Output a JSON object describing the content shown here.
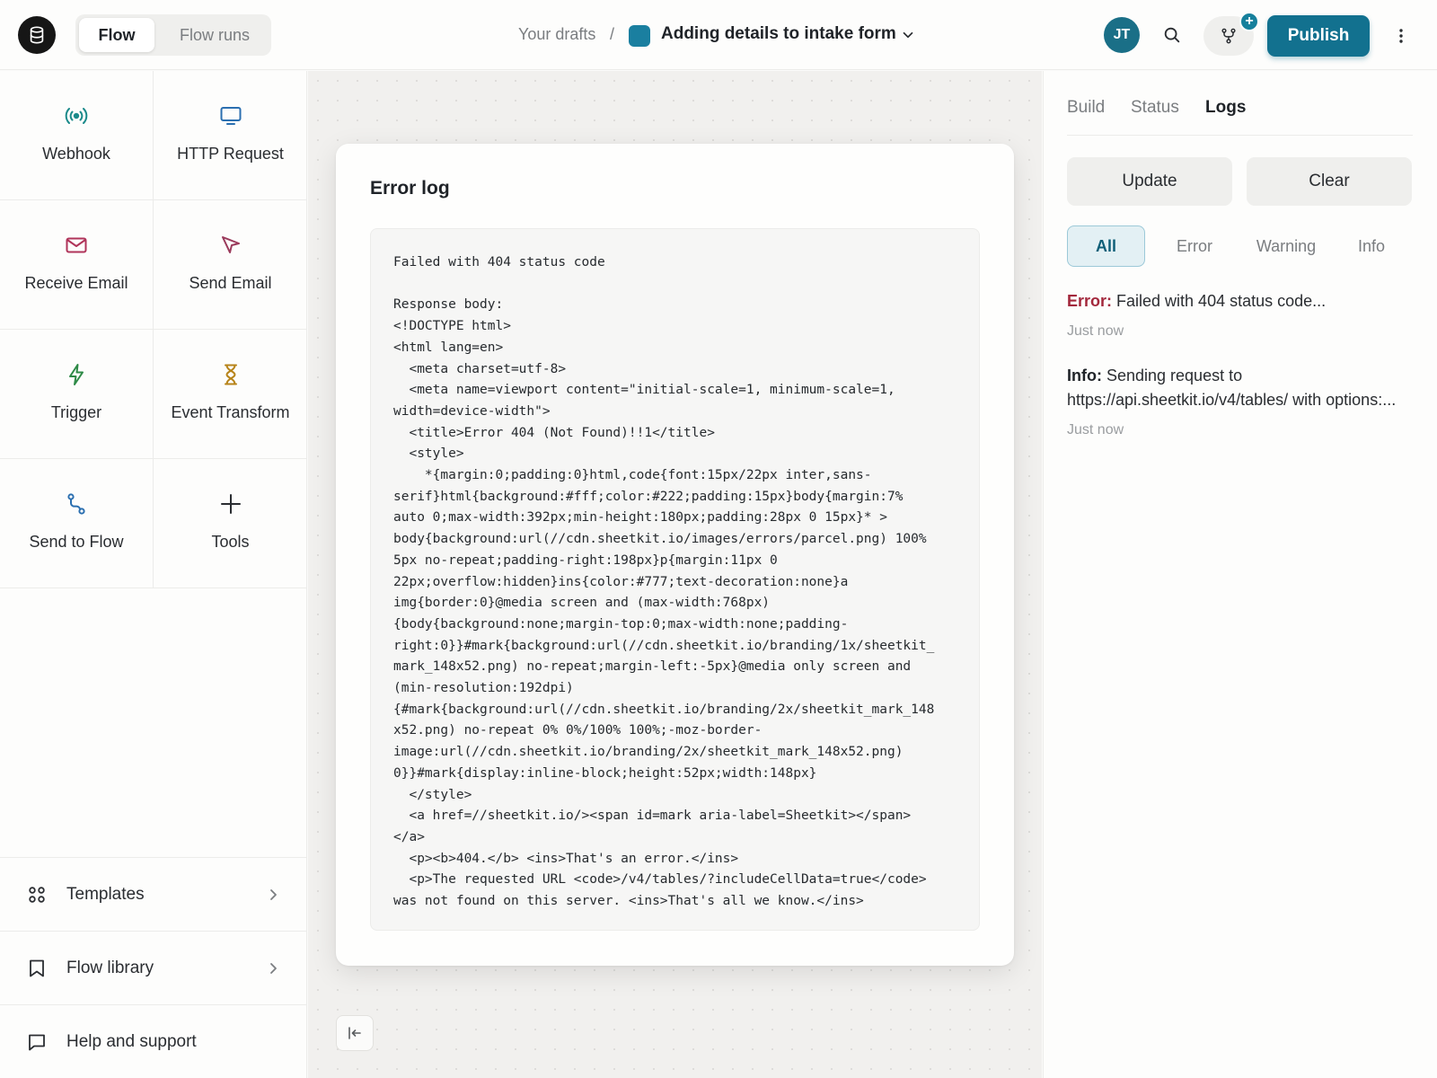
{
  "header": {
    "tabs": [
      {
        "label": "Flow",
        "active": true
      },
      {
        "label": "Flow runs",
        "active": false
      }
    ],
    "breadcrumb_root": "Your drafts",
    "breadcrumb_sep": "/",
    "draft_title": "Adding details to intake form",
    "avatar_initials": "JT",
    "branch_badge": "+",
    "publish_label": "Publish"
  },
  "sidebar": {
    "tools": [
      {
        "label": "Webhook",
        "icon": "webhook-icon",
        "color": "#1a8a8a"
      },
      {
        "label": "HTTP Request",
        "icon": "monitor-icon",
        "color": "#2b6fb0"
      },
      {
        "label": "Receive Email",
        "icon": "mail-icon",
        "color": "#b0345a"
      },
      {
        "label": "Send Email",
        "icon": "send-icon",
        "color": "#9b3b5c"
      },
      {
        "label": "Trigger",
        "icon": "bolt-icon",
        "color": "#2e8a47"
      },
      {
        "label": "Event Transform",
        "icon": "hourglass-icon",
        "color": "#b7841a"
      },
      {
        "label": "Send to Flow",
        "icon": "route-icon",
        "color": "#2b6fb0"
      },
      {
        "label": "Tools",
        "icon": "plus-icon",
        "color": "#2a2d31"
      }
    ],
    "links": [
      {
        "label": "Templates",
        "icon": "grid-icon"
      },
      {
        "label": "Flow library",
        "icon": "bookmark-icon"
      },
      {
        "label": "Help and support",
        "icon": "chat-icon"
      }
    ]
  },
  "error_card": {
    "title": "Error log",
    "code": "Failed with 404 status code\n\nResponse body:\n<!DOCTYPE html>\n<html lang=en>\n  <meta charset=utf-8>\n  <meta name=viewport content=\"initial-scale=1, minimum-scale=1,\nwidth=device-width\">\n  <title>Error 404 (Not Found)!!1</title>\n  <style>\n    *{margin:0;padding:0}html,code{font:15px/22px inter,sans-\nserif}html{background:#fff;color:#222;padding:15px}body{margin:7%\nauto 0;max-width:392px;min-height:180px;padding:28px 0 15px}* >\nbody{background:url(//cdn.sheetkit.io/images/errors/parcel.png) 100%\n5px no-repeat;padding-right:198px}p{margin:11px 0\n22px;overflow:hidden}ins{color:#777;text-decoration:none}a\nimg{border:0}@media screen and (max-width:768px)\n{body{background:none;margin-top:0;max-width:none;padding-\nright:0}}#mark{background:url(//cdn.sheetkit.io/branding/1x/sheetkit_\nmark_148x52.png) no-repeat;margin-left:-5px}@media only screen and\n(min-resolution:192dpi)\n{#mark{background:url(//cdn.sheetkit.io/branding/2x/sheetkit_mark_148\nx52.png) no-repeat 0% 0%/100% 100%;-moz-border-\nimage:url(//cdn.sheetkit.io/branding/2x/sheetkit_mark_148x52.png)\n0}}#mark{display:inline-block;height:52px;width:148px}\n  </style>\n  <a href=//sheetkit.io/><span id=mark aria-label=Sheetkit></span>\n</a>\n  <p><b>404.</b> <ins>That's an error.</ins>\n  <p>The requested URL <code>/v4/tables/?includeCellData=true</code>\nwas not found on this server. <ins>That's all we know.</ins>"
  },
  "right_panel": {
    "tabs": [
      {
        "label": "Build",
        "active": false
      },
      {
        "label": "Status",
        "active": false
      },
      {
        "label": "Logs",
        "active": true
      }
    ],
    "update_label": "Update",
    "clear_label": "Clear",
    "filters": [
      {
        "label": "All",
        "active": true
      },
      {
        "label": "Error",
        "active": false
      },
      {
        "label": "Warning",
        "active": false
      },
      {
        "label": "Info",
        "active": false
      }
    ],
    "logs": [
      {
        "level": "Error:",
        "message": " Failed with 404 status code...",
        "time": "Just now"
      },
      {
        "level": "Info:",
        "message": " Sending request to https://api.sheetkit.io/v4/tables/ with options:...",
        "time": "Just now"
      }
    ]
  },
  "colors": {
    "accent": "#12718f",
    "error": "#a3283c"
  }
}
